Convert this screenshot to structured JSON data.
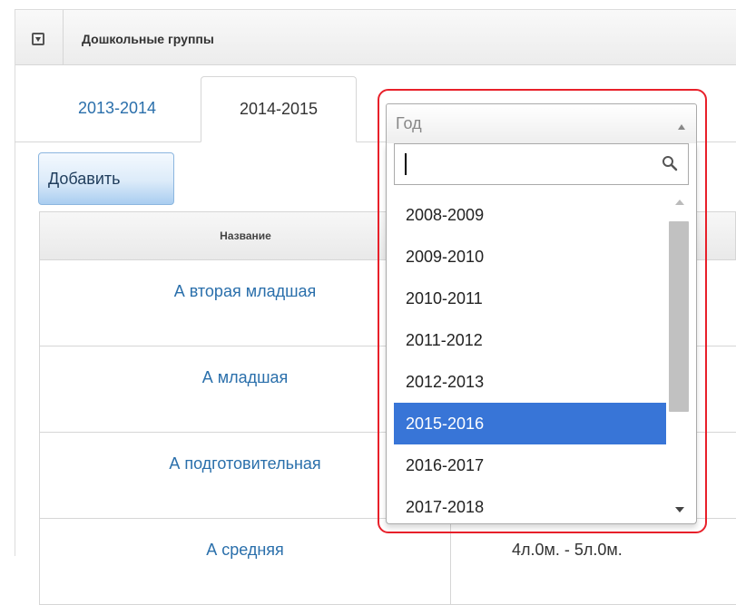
{
  "panel": {
    "title": "Дошкольные группы",
    "collapse_icon": "collapse-square-icon"
  },
  "tabs": [
    {
      "label": "2013-2014",
      "active": false
    },
    {
      "label": "2014-2015",
      "active": true
    }
  ],
  "toolbar": {
    "add_label": "Добавить"
  },
  "table": {
    "headers": {
      "name": "Название"
    },
    "rows": [
      {
        "name": "А вторая младшая",
        "time": ""
      },
      {
        "name": "А младшая",
        "time": ""
      },
      {
        "name": "А подготовительная",
        "time": ""
      },
      {
        "name": "А средняя",
        "time": "4л.0м. - 5л.0м."
      }
    ]
  },
  "year_select": {
    "placeholder": "Год",
    "search_value": "",
    "options": [
      "2008-2009",
      "2009-2010",
      "2010-2011",
      "2011-2012",
      "2012-2013",
      "2015-2016",
      "2016-2017",
      "2017-2018"
    ],
    "highlighted": "2015-2016"
  },
  "colors": {
    "accent": "#3875d7",
    "link": "#2a6fab",
    "highlight_frame": "#e8202a"
  }
}
